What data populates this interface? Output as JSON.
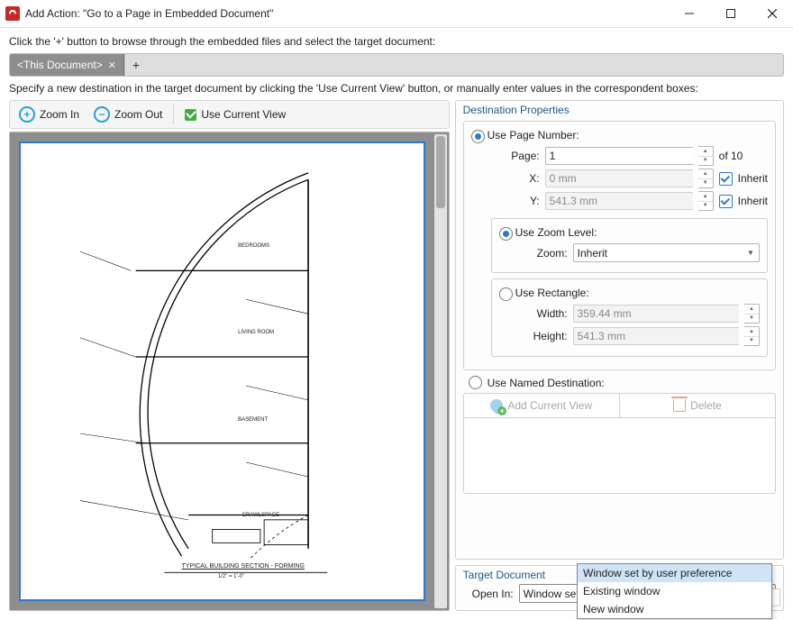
{
  "window": {
    "title": "Add Action: \"Go to a Page in Embedded Document\""
  },
  "instructions": {
    "top": "Click the '+' button to browse through the embedded files and select the target document:",
    "mid": "Specify a new destination in the target document by clicking the 'Use Current View' button, or manually enter values in the correspondent boxes:"
  },
  "tabs": {
    "items": [
      {
        "label": "<This Document>"
      }
    ],
    "add": "+"
  },
  "toolbar": {
    "zoom_in": "Zoom In",
    "zoom_out": "Zoom Out",
    "use_current": "Use Current View"
  },
  "preview": {
    "title": "TYPICAL BUILDING SECTION - FORMING",
    "scale": "1/2\" = 1'-0\"",
    "rooms": {
      "bedrooms": "BEDROOMS",
      "living": "LIVING ROOM",
      "basement": "BASEMENT",
      "crawl": "CRAWLSPACE"
    }
  },
  "dest": {
    "group_title": "Destination Properties",
    "use_page": "Use Page Number:",
    "page_lbl": "Page:",
    "page_val": "1",
    "of_lbl": "of 10",
    "x_lbl": "X:",
    "x_val": "0 mm",
    "y_lbl": "Y:",
    "y_val": "541.3 mm",
    "inherit": "Inherit",
    "use_zoom": "Use Zoom Level:",
    "zoom_lbl": "Zoom:",
    "zoom_val": "Inherit",
    "use_rect": "Use Rectangle:",
    "w_lbl": "Width:",
    "w_val": "359.44 mm",
    "h_lbl": "Height:",
    "h_val": "541.3 mm",
    "use_named": "Use Named Destination:",
    "add_current": "Add Current View",
    "delete": "Delete"
  },
  "target": {
    "group_title": "Target Document",
    "open_in_lbl": "Open In:",
    "open_in_val": "Window set by user preference",
    "options": [
      "Window set by user preference",
      "Existing window",
      "New window"
    ]
  }
}
